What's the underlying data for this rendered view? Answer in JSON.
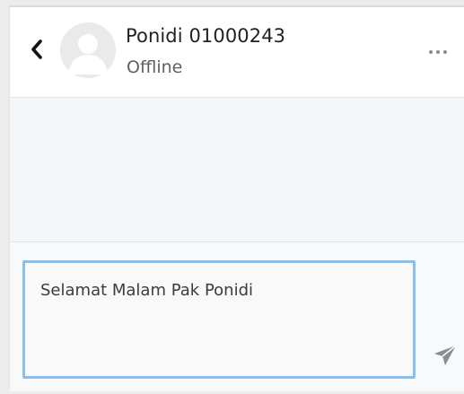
{
  "header": {
    "contact_name": "Ponidi 01000243",
    "contact_status": "Offline",
    "back_icon": "chevron-left-icon",
    "more_icon": "more-horizontal-icon",
    "avatar_icon": "user-placeholder-icon"
  },
  "composer": {
    "message_value": "Selamat Malam Pak Ponidi",
    "send_icon": "send-icon"
  },
  "colors": {
    "input_focus_border": "#86bff0",
    "message_area_bg": "#f5f6f8",
    "icon_gray": "#8a8d92"
  }
}
